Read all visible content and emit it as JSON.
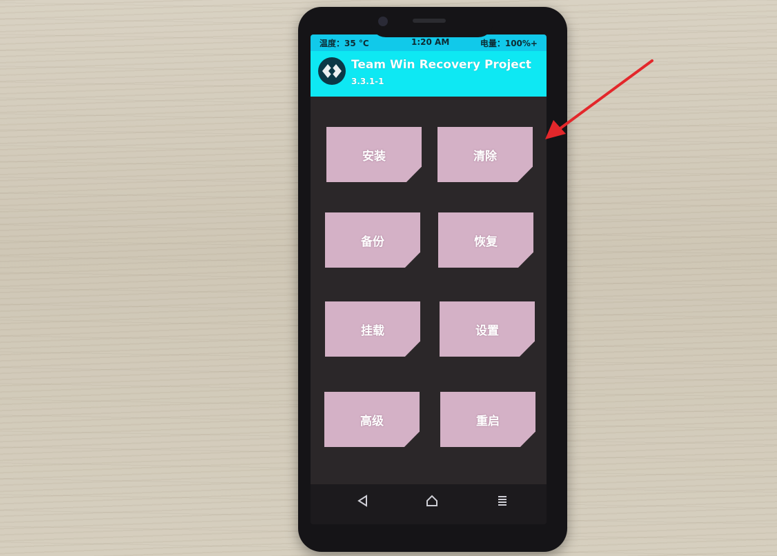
{
  "status_bar": {
    "temperature": "温度：35 °C",
    "time": "1:20 AM",
    "battery": "电量：100%+"
  },
  "header": {
    "title": "Team Win Recovery Project",
    "version": "3.3.1-1",
    "logo_icon": "twrp-logo-icon"
  },
  "menu": {
    "install": "安装",
    "wipe": "清除",
    "backup": "备份",
    "restore": "恢复",
    "mount": "挂载",
    "settings": "设置",
    "advanced": "高级",
    "reboot": "重启"
  },
  "navbar": {
    "back_icon": "back-triangle-icon",
    "home_icon": "home-icon",
    "menu_icon": "menu-icon"
  },
  "colors": {
    "status_bar": "#11c9ea",
    "header": "#0ee8f3",
    "button": "#d4b1c6",
    "screen_bg": "#2b2729",
    "annotation_arrow": "#e3272b"
  }
}
